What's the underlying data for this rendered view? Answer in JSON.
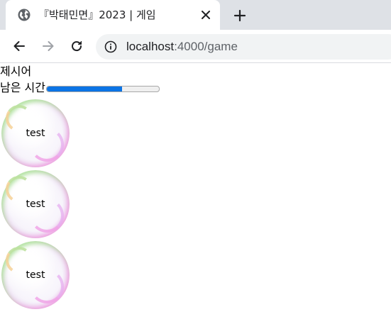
{
  "browser": {
    "tab": {
      "title": "『박태민면』2023 | 게임",
      "favicon": "globe-icon",
      "close_icon": "close-icon"
    },
    "new_tab_icon": "plus-icon",
    "nav": {
      "back_icon": "back-arrow-icon",
      "forward_icon": "forward-arrow-icon",
      "reload_icon": "reload-icon"
    },
    "address_bar": {
      "info_icon": "info-icon",
      "host": "localhost",
      "path": ":4000/game"
    }
  },
  "game": {
    "hint_label": "제시어",
    "timer_label": "남은 시간",
    "time_remaining_fraction": 0.67,
    "accent_color": "#0b74e5",
    "bubbles": [
      {
        "text": "test"
      },
      {
        "text": "test"
      },
      {
        "text": "test"
      }
    ]
  }
}
